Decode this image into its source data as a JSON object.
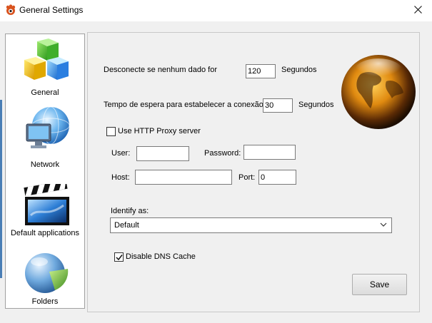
{
  "window": {
    "title": "General Settings",
    "close_icon": "close-icon"
  },
  "sidebar": {
    "items": [
      {
        "label": "General",
        "icon": "cubes-icon"
      },
      {
        "label": "Network",
        "icon": "network-globe-icon"
      },
      {
        "label": "Default applications",
        "icon": "clapperboard-icon"
      },
      {
        "label": "Folders",
        "icon": "pie-chart-icon"
      }
    ]
  },
  "settings": {
    "disconnect_label": "Desconecte se nenhum dado for",
    "disconnect_value": "120",
    "disconnect_unit": "Segundos",
    "timeout_label": "Tempo de espera para estabelecer a conexão",
    "timeout_value": "30",
    "timeout_unit": "Segundos",
    "proxy_checkbox_label": "Use HTTP Proxy server",
    "proxy_checked": false,
    "user_label": "User:",
    "user_value": "",
    "password_label": "Password:",
    "password_value": "",
    "host_label": "Host:",
    "host_value": "",
    "port_label": "Port:",
    "port_value": "0",
    "identify_label": "Identify as:",
    "identify_selected": "Default",
    "dns_checkbox_label": "Disable DNS Cache",
    "dns_checked": true,
    "save_label": "Save",
    "globe_icon": "globe-icon"
  }
}
